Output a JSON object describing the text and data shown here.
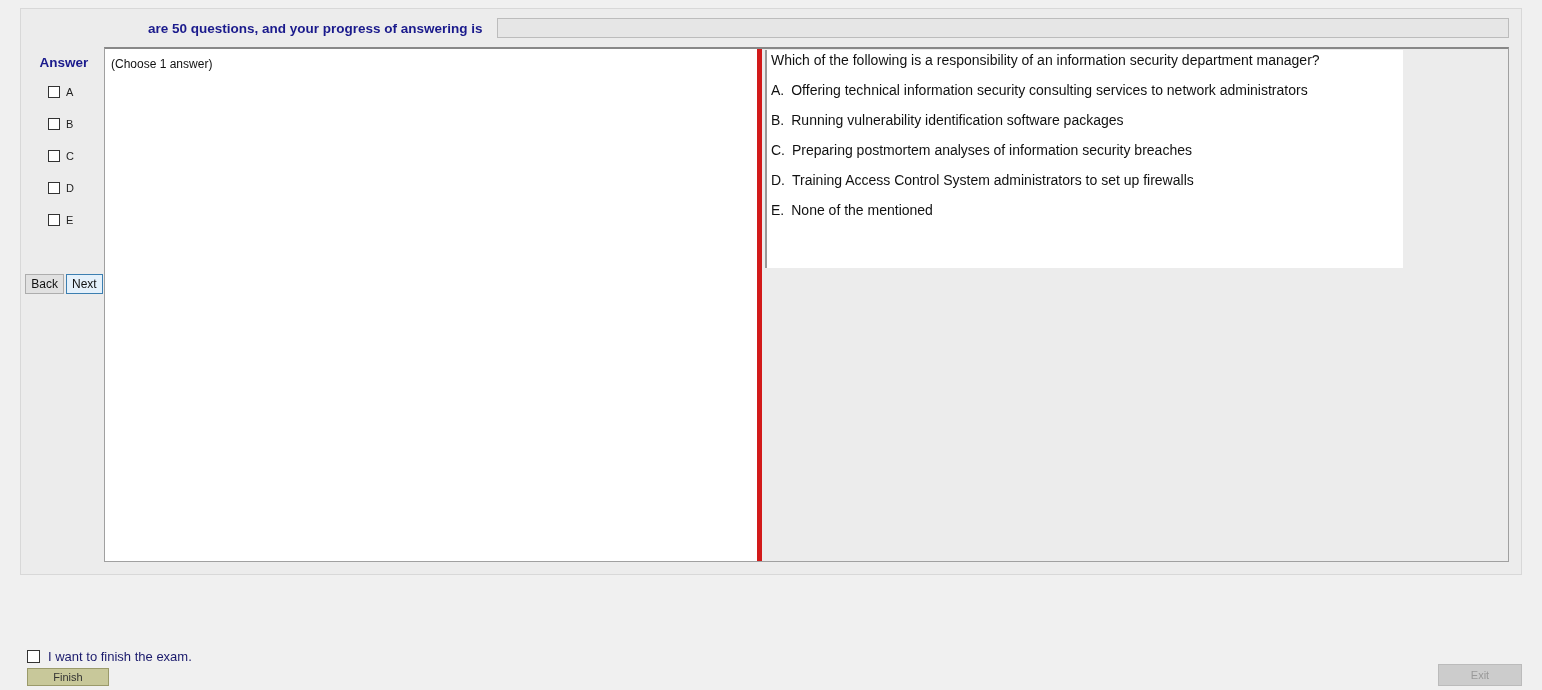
{
  "header": {
    "text": "are 50 questions, and your progress of answering is",
    "progress": {
      "level": 0
    }
  },
  "answer_panel": {
    "title": "Answer",
    "options": [
      {
        "label": "A",
        "checked": false
      },
      {
        "label": "B",
        "checked": false
      },
      {
        "label": "C",
        "checked": false
      },
      {
        "label": "D",
        "checked": false
      },
      {
        "label": "E",
        "checked": false
      }
    ],
    "buttons": [
      {
        "label": "Back",
        "selected": false
      },
      {
        "label": "Next",
        "selected": true
      }
    ]
  },
  "instruction": "(Choose 1 answer)",
  "question": {
    "text": "Which of the following is a responsibility of an information security department manager?",
    "choices": [
      {
        "letter": "A.",
        "text": "Offering technical information security consulting services to network administrators"
      },
      {
        "letter": "B.",
        "text": "Running vulnerability identification software packages"
      },
      {
        "letter": "C.",
        "text": "Preparing postmortem analyses of information security breaches"
      },
      {
        "letter": "D.",
        "text": "Training Access Control System administrators to set up firewalls"
      },
      {
        "letter": "E.",
        "text": "None of the mentioned"
      }
    ]
  },
  "footer": {
    "finish_checkbox": {
      "label": "I want to finish the exam.",
      "checked": false
    },
    "finish_button": {
      "label": "Finish",
      "disabled": false
    },
    "exit_button": {
      "label": "Exit",
      "disabled": true
    }
  }
}
